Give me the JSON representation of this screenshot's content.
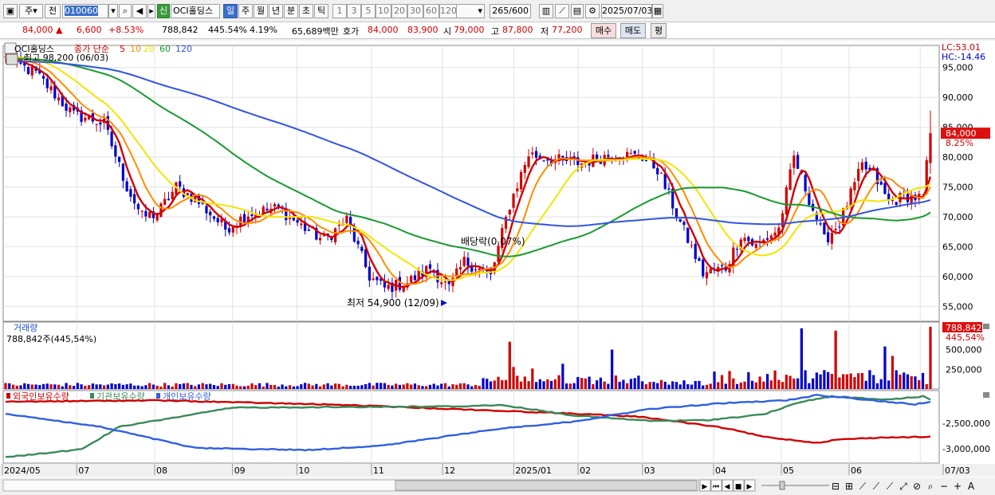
{
  "toolbar": {
    "period_select": "주",
    "prev_label": "전",
    "code": "010060",
    "badge": "신",
    "stock_name": "OCI홀딩스",
    "tabs": [
      "일",
      "주",
      "월",
      "년",
      "분",
      "초",
      "틱"
    ],
    "active_tab": "일",
    "intervals": [
      "1",
      "3",
      "5",
      "10",
      "20",
      "30",
      "60",
      "120"
    ],
    "count": "265",
    "count_total": "/600",
    "date": "2025/07/03"
  },
  "info": {
    "price": "84,000",
    "change": "6,600",
    "change_pct": "+8.53%",
    "volume": "788,842",
    "volume_ratio": "445.54%",
    "turnover": "4.19%",
    "amount": "65,689백만",
    "quote_label": "호가",
    "ask": "84,000",
    "bid": "83,900",
    "open_label": "시",
    "open": "79,000",
    "high_label": "고",
    "high": "87,800",
    "low_label": "저",
    "low": "77,200",
    "buy_label": "매수",
    "sell_label": "매도",
    "eval_label": "평"
  },
  "colors": {
    "up": "#d00000",
    "down": "#0000d0",
    "ma5": "#d00000",
    "ma10": "#ff8c00",
    "ma20": "#f2e600",
    "ma60": "#1a9a30",
    "ma120": "#3355dd",
    "foreign": "#d00000",
    "institution": "#3a8a5a",
    "individual": "#3060e0"
  },
  "chart_data": [
    {
      "type": "candlestick",
      "legend_name": "OCI홀딩스",
      "legend_items": [
        "종가 단순",
        "5",
        "10",
        "20",
        "60",
        "120"
      ],
      "max_label": "최고 98,200 (06/03)",
      "min_label": "최저 54,900 (12/09)",
      "dividend_label": "배당락(0.07%)",
      "lc_label": "LC:53.01",
      "hc_label": "HC:-14.46",
      "last_price_label": "84,000",
      "last_pct_label": "8.25%",
      "y_ticks": [
        95000,
        90000,
        85000,
        80000,
        75000,
        70000,
        65000,
        60000,
        55000
      ],
      "y_tick_labels": [
        "95,000",
        "90,000",
        "85,000",
        "80,000",
        "75,000",
        "70,000",
        "65,000",
        "60,000",
        "55,000"
      ],
      "ylim": [
        52500,
        98700
      ],
      "x_labels": [
        "2024/05",
        "07",
        "08",
        "09",
        "10",
        "11",
        "12",
        "2025/01",
        "02",
        "03",
        "04",
        "05",
        "06",
        "07",
        "07/03"
      ],
      "anchors": [
        [
          0,
          96500
        ],
        [
          8,
          94000
        ],
        [
          18,
          87000
        ],
        [
          22,
          86500
        ],
        [
          26,
          85500
        ],
        [
          32,
          75000
        ],
        [
          36,
          70000
        ],
        [
          40,
          70500
        ],
        [
          45,
          75000
        ],
        [
          50,
          73000
        ],
        [
          58,
          68000
        ],
        [
          64,
          70500
        ],
        [
          72,
          71500
        ],
        [
          78,
          68500
        ],
        [
          84,
          66000
        ],
        [
          90,
          69500
        ],
        [
          96,
          60000
        ],
        [
          100,
          58000
        ],
        [
          106,
          59000
        ],
        [
          112,
          61500
        ],
        [
          117,
          58000
        ],
        [
          121,
          62500
        ],
        [
          126,
          61000
        ],
        [
          128,
          60000
        ],
        [
          133,
          72000
        ],
        [
          138,
          80500
        ],
        [
          145,
          79500
        ],
        [
          152,
          79000
        ],
        [
          160,
          80500
        ],
        [
          168,
          80000
        ],
        [
          172,
          78000
        ],
        [
          178,
          69000
        ],
        [
          184,
          60500
        ],
        [
          190,
          61500
        ],
        [
          194,
          67000
        ],
        [
          198,
          65000
        ],
        [
          204,
          68000
        ],
        [
          208,
          80000
        ],
        [
          212,
          73000
        ],
        [
          216,
          66000
        ],
        [
          220,
          69000
        ],
        [
          226,
          78500
        ],
        [
          229,
          77000
        ],
        [
          233,
          72500
        ],
        [
          238,
          73500
        ],
        [
          242,
          73000
        ],
        [
          244,
          84000
        ]
      ],
      "ma_labels": [
        "5",
        "10",
        "20",
        "60",
        "120"
      ]
    },
    {
      "type": "bar",
      "title": "거래량",
      "value_label": "788,842주(445,54%)",
      "last_label": "788,842",
      "last_pct_label": "445,54%",
      "y_tick_labels": [
        "500,000",
        "250,000"
      ],
      "y_ticks": [
        500000,
        250000
      ],
      "ylim": [
        0,
        850000
      ]
    },
    {
      "type": "line",
      "series": [
        {
          "name": "외국인보유수량"
        },
        {
          "name": "기관보유수량"
        },
        {
          "name": "개인보유수량"
        }
      ],
      "y_tick_labels": [
        "-2,500,000",
        "-3,000,000"
      ]
    }
  ]
}
